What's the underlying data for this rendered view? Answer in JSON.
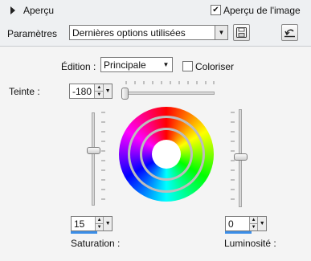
{
  "header": {
    "preview_label": "Aperçu",
    "image_preview_label": "Aperçu de l'image",
    "image_preview_checked": true
  },
  "params": {
    "label": "Paramètres",
    "preset_value": "Dernières options utilisées"
  },
  "edition": {
    "label": "Édition :",
    "value": "Principale",
    "colorize_label": "Coloriser",
    "colorize_checked": false
  },
  "hue": {
    "label": "Teinte :",
    "value": "-180"
  },
  "saturation": {
    "label": "Saturation :",
    "value": "15"
  },
  "luminosity": {
    "label": "Luminosité :",
    "value": "0"
  },
  "icons": {
    "expand": "triangle-right-icon",
    "save_preset": "floppy-disk-icon",
    "reset": "reset-arrow-icon",
    "check": "checkmark-icon"
  }
}
